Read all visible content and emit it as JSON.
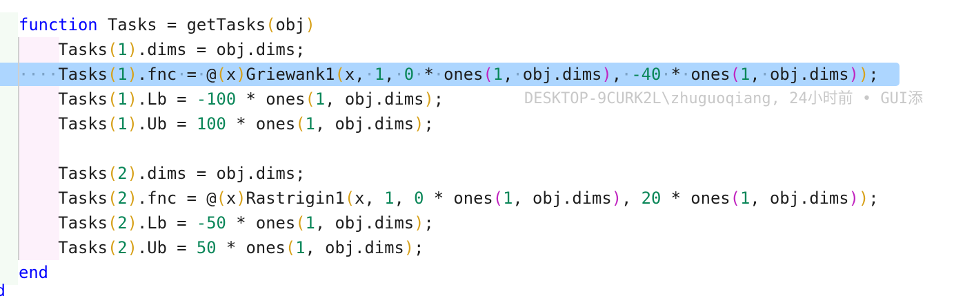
{
  "lines": [
    {
      "tokens": [
        {
          "t": "function",
          "c": "kw"
        },
        {
          "t": " Tasks = getTasks"
        },
        {
          "t": "(",
          "c": "p1"
        },
        {
          "t": "obj"
        },
        {
          "t": ")",
          "c": "p1"
        }
      ]
    },
    {
      "tokens": [
        {
          "t": "    Tasks"
        },
        {
          "t": "(",
          "c": "p1"
        },
        {
          "t": "1",
          "c": "num"
        },
        {
          "t": ")",
          "c": "p1"
        },
        {
          "t": ".dims = obj.dims;"
        }
      ]
    },
    {
      "tokens": [
        {
          "t": "····",
          "c": "ws"
        },
        {
          "t": "Tasks"
        },
        {
          "t": "(",
          "c": "p1"
        },
        {
          "t": "1",
          "c": "num"
        },
        {
          "t": ")",
          "c": "p1"
        },
        {
          "t": ".fnc"
        },
        {
          "t": "·",
          "c": "ws"
        },
        {
          "t": "="
        },
        {
          "t": "·",
          "c": "ws"
        },
        {
          "t": "@"
        },
        {
          "t": "(",
          "c": "p1"
        },
        {
          "t": "x"
        },
        {
          "t": ")",
          "c": "p1"
        },
        {
          "t": "Griewank1"
        },
        {
          "t": "(",
          "c": "p1"
        },
        {
          "t": "x,"
        },
        {
          "t": "·",
          "c": "ws"
        },
        {
          "t": "1",
          "c": "num"
        },
        {
          "t": ","
        },
        {
          "t": "·",
          "c": "ws"
        },
        {
          "t": "0",
          "c": "num"
        },
        {
          "t": "·",
          "c": "ws"
        },
        {
          "t": "*"
        },
        {
          "t": "·",
          "c": "ws"
        },
        {
          "t": "ones"
        },
        {
          "t": "(",
          "c": "p2"
        },
        {
          "t": "1",
          "c": "num"
        },
        {
          "t": ","
        },
        {
          "t": "·",
          "c": "ws"
        },
        {
          "t": "obj.dims"
        },
        {
          "t": ")",
          "c": "p2"
        },
        {
          "t": ","
        },
        {
          "t": "·",
          "c": "ws"
        },
        {
          "t": "-40",
          "c": "num"
        },
        {
          "t": "·",
          "c": "ws"
        },
        {
          "t": "*"
        },
        {
          "t": "·",
          "c": "ws"
        },
        {
          "t": "ones"
        },
        {
          "t": "(",
          "c": "p2"
        },
        {
          "t": "1",
          "c": "num"
        },
        {
          "t": ","
        },
        {
          "t": "·",
          "c": "ws"
        },
        {
          "t": "obj.dims"
        },
        {
          "t": ")",
          "c": "p2"
        },
        {
          "t": ")",
          "c": "p1"
        },
        {
          "t": ";"
        }
      ]
    },
    {
      "tokens": [
        {
          "t": "    Tasks"
        },
        {
          "t": "(",
          "c": "p1"
        },
        {
          "t": "1",
          "c": "num"
        },
        {
          "t": ")",
          "c": "p1"
        },
        {
          "t": ".Lb = "
        },
        {
          "t": "-100",
          "c": "num"
        },
        {
          "t": " * ones"
        },
        {
          "t": "(",
          "c": "p1"
        },
        {
          "t": "1",
          "c": "num"
        },
        {
          "t": ", obj.dims"
        },
        {
          "t": ")",
          "c": "p1"
        },
        {
          "t": ";"
        }
      ]
    },
    {
      "tokens": [
        {
          "t": "    Tasks"
        },
        {
          "t": "(",
          "c": "p1"
        },
        {
          "t": "1",
          "c": "num"
        },
        {
          "t": ")",
          "c": "p1"
        },
        {
          "t": ".Ub = "
        },
        {
          "t": "100",
          "c": "num"
        },
        {
          "t": " * ones"
        },
        {
          "t": "(",
          "c": "p1"
        },
        {
          "t": "1",
          "c": "num"
        },
        {
          "t": ", obj.dims"
        },
        {
          "t": ")",
          "c": "p1"
        },
        {
          "t": ";"
        }
      ]
    },
    {
      "tokens": []
    },
    {
      "tokens": [
        {
          "t": "    Tasks"
        },
        {
          "t": "(",
          "c": "p1"
        },
        {
          "t": "2",
          "c": "num"
        },
        {
          "t": ")",
          "c": "p1"
        },
        {
          "t": ".dims = obj.dims;"
        }
      ]
    },
    {
      "tokens": [
        {
          "t": "    Tasks"
        },
        {
          "t": "(",
          "c": "p1"
        },
        {
          "t": "2",
          "c": "num"
        },
        {
          "t": ")",
          "c": "p1"
        },
        {
          "t": ".fnc = @"
        },
        {
          "t": "(",
          "c": "p1"
        },
        {
          "t": "x"
        },
        {
          "t": ")",
          "c": "p1"
        },
        {
          "t": "Rastrigin1"
        },
        {
          "t": "(",
          "c": "p1"
        },
        {
          "t": "x, "
        },
        {
          "t": "1",
          "c": "num"
        },
        {
          "t": ", "
        },
        {
          "t": "0",
          "c": "num"
        },
        {
          "t": " * ones"
        },
        {
          "t": "(",
          "c": "p2"
        },
        {
          "t": "1",
          "c": "num"
        },
        {
          "t": ", obj.dims"
        },
        {
          "t": ")",
          "c": "p2"
        },
        {
          "t": ", "
        },
        {
          "t": "20",
          "c": "num"
        },
        {
          "t": " * ones"
        },
        {
          "t": "(",
          "c": "p2"
        },
        {
          "t": "1",
          "c": "num"
        },
        {
          "t": ", obj.dims"
        },
        {
          "t": ")",
          "c": "p2"
        },
        {
          "t": ")",
          "c": "p1"
        },
        {
          "t": ";"
        }
      ]
    },
    {
      "tokens": [
        {
          "t": "    Tasks"
        },
        {
          "t": "(",
          "c": "p1"
        },
        {
          "t": "2",
          "c": "num"
        },
        {
          "t": ")",
          "c": "p1"
        },
        {
          "t": ".Lb = "
        },
        {
          "t": "-50",
          "c": "num"
        },
        {
          "t": " * ones"
        },
        {
          "t": "(",
          "c": "p1"
        },
        {
          "t": "1",
          "c": "num"
        },
        {
          "t": ", obj.dims"
        },
        {
          "t": ")",
          "c": "p1"
        },
        {
          "t": ";"
        }
      ]
    },
    {
      "tokens": [
        {
          "t": "    Tasks"
        },
        {
          "t": "(",
          "c": "p1"
        },
        {
          "t": "2",
          "c": "num"
        },
        {
          "t": ")",
          "c": "p1"
        },
        {
          "t": ".Ub = "
        },
        {
          "t": "50",
          "c": "num"
        },
        {
          "t": " * ones"
        },
        {
          "t": "(",
          "c": "p1"
        },
        {
          "t": "1",
          "c": "num"
        },
        {
          "t": ", obj.dims"
        },
        {
          "t": ")",
          "c": "p1"
        },
        {
          "t": ";"
        }
      ]
    },
    {
      "tokens": [
        {
          "t": "end",
          "c": "kw"
        }
      ]
    }
  ],
  "blame": "DESKTOP-9CURK2L\\zhuguoqiang, 24小时前 • GUI添",
  "stray_char": "d"
}
